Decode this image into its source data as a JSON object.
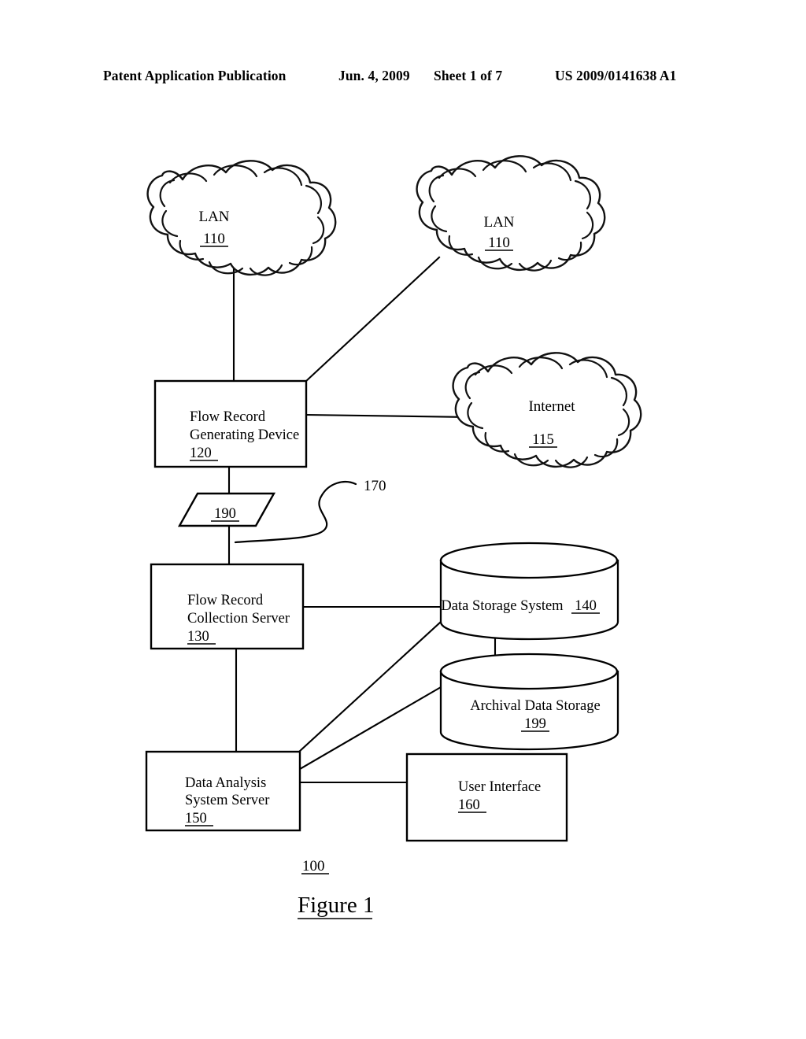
{
  "header": {
    "publication": "Patent Application Publication",
    "date": "Jun. 4, 2009",
    "sheet": "Sheet 1 of 7",
    "patent_number": "US 2009/0141638 A1"
  },
  "figure": {
    "caption": "Figure 1",
    "system_ref": "100"
  },
  "nodes": {
    "lan_left": {
      "label": "LAN",
      "ref": "110"
    },
    "lan_right": {
      "label": "LAN",
      "ref": "110"
    },
    "internet": {
      "label": "Internet",
      "ref": "115"
    },
    "flow_record_generating_device": {
      "line1": "Flow Record",
      "line2": "Generating Device",
      "ref": "120"
    },
    "flow_record": {
      "ref": "190"
    },
    "flow_record_leader": {
      "ref": "170"
    },
    "flow_record_collection_server": {
      "line1": "Flow Record",
      "line2": "Collection Server",
      "ref": "130"
    },
    "data_storage_system": {
      "label": "Data Storage System",
      "ref": "140"
    },
    "archival_data_storage": {
      "label": "Archival Data Storage",
      "ref": "199"
    },
    "data_analysis_system_server": {
      "line1": "Data Analysis",
      "line2": "System Server",
      "ref": "150"
    },
    "user_interface": {
      "label": "User Interface",
      "ref": "160"
    }
  },
  "colors": {
    "ink": "#000000",
    "paper": "#ffffff"
  }
}
